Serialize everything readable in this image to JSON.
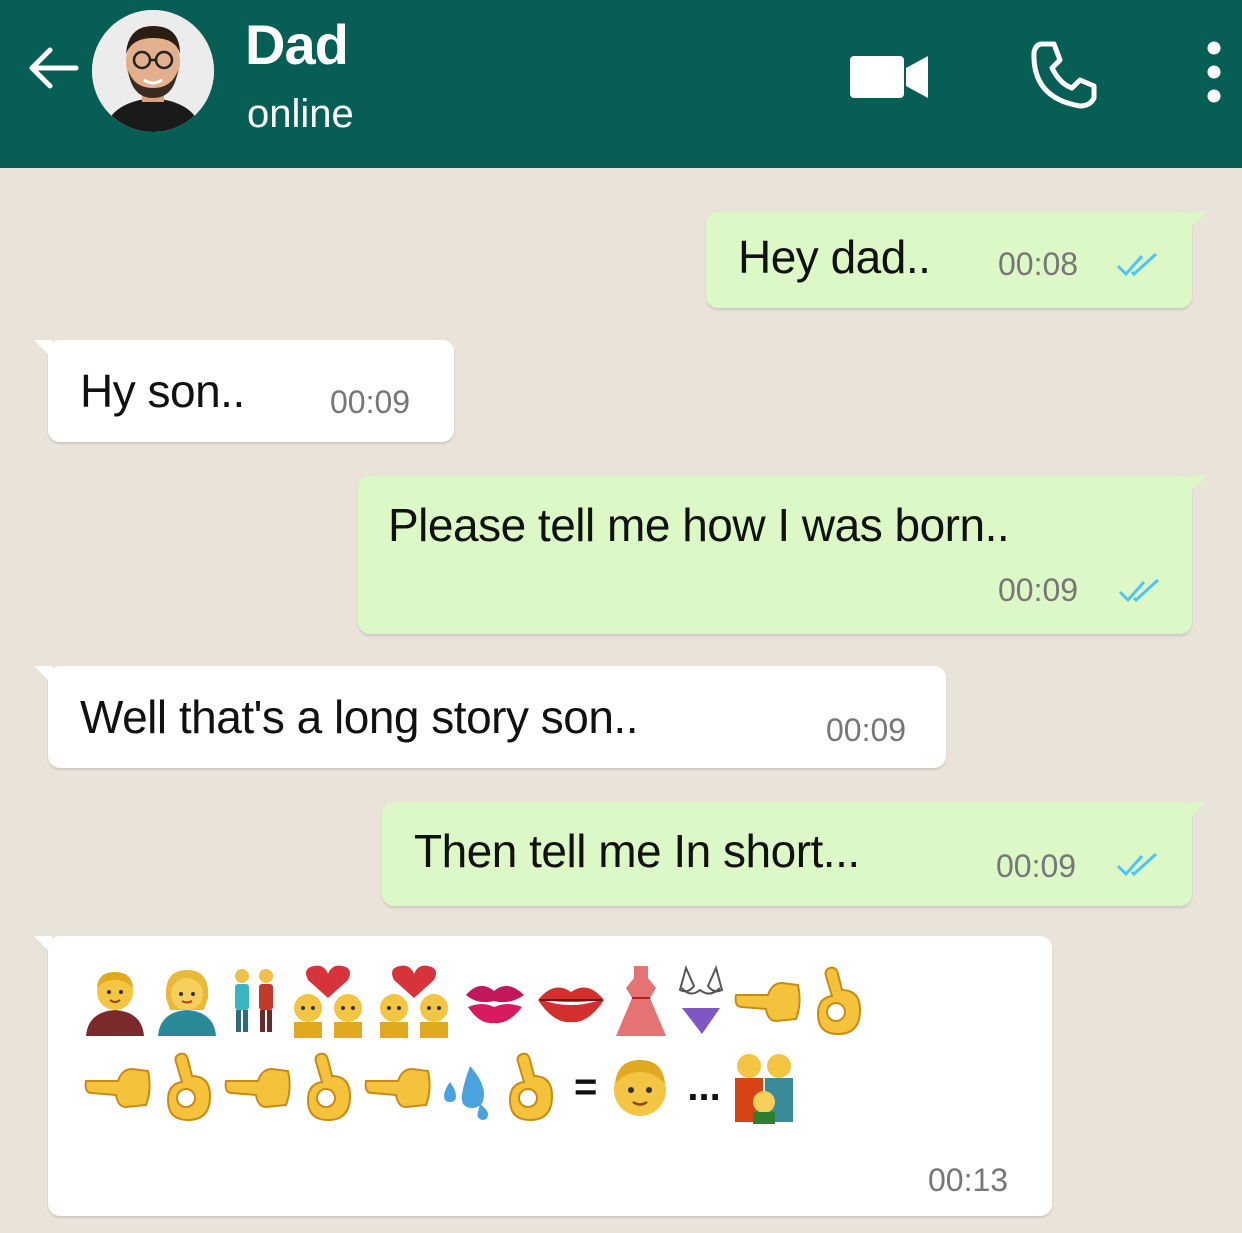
{
  "header": {
    "contact_name": "Dad",
    "status": "online",
    "background_color": "#075e54",
    "icons": [
      "back-arrow-icon",
      "video-call-icon",
      "voice-call-icon",
      "more-options-icon"
    ]
  },
  "messages": [
    {
      "direction": "outgoing",
      "text": "Hey dad..",
      "time": "00:08",
      "read": true
    },
    {
      "direction": "incoming",
      "text": "Hy son..",
      "time": "00:09"
    },
    {
      "direction": "outgoing",
      "text": "Please tell me how I was born..",
      "time": "00:09",
      "read": true
    },
    {
      "direction": "incoming",
      "text": "Well that's a long story son..",
      "time": "00:09"
    },
    {
      "direction": "outgoing",
      "text": "Then tell me In short...",
      "time": "00:09",
      "read": true
    },
    {
      "direction": "incoming",
      "time": "00:13",
      "emoji_line_1": [
        "man",
        "woman",
        "couple",
        "couple-with-heart",
        "couple-with-heart",
        "kiss-mark",
        "lips",
        "dress",
        "bikini",
        "backhand-index-pointing-left",
        "ok-hand"
      ],
      "emoji_line_2": [
        "backhand-index-pointing-left",
        "ok-hand",
        "backhand-index-pointing-left",
        "ok-hand",
        "backhand-index-pointing-left",
        "sweat-droplets",
        "ok-hand"
      ],
      "equals": "=",
      "ellipsis": "...",
      "emoji_result": [
        "boy",
        "family"
      ]
    }
  ],
  "colors": {
    "outgoing_bubble": "#dcf8c6",
    "incoming_bubble": "#ffffff",
    "read_ticks": "#4fc3f7"
  }
}
